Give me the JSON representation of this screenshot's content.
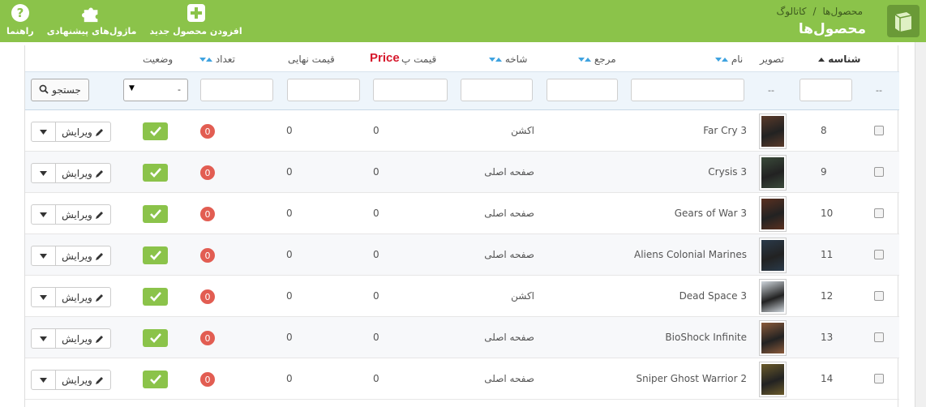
{
  "header": {
    "breadcrumb": [
      "کاتالوگ",
      "محصول‌ها"
    ],
    "breadcrumb_separator": "/",
    "title": "محصول‌ها",
    "toolbar": [
      {
        "label": "افزودن محصول جدید",
        "icon": "plus-square-icon"
      },
      {
        "label": "ماژول‌های پیشنهادی",
        "icon": "puzzle-icon"
      },
      {
        "label": "راهنما",
        "icon": "help-icon"
      }
    ],
    "bg_color": "#8bc34a"
  },
  "columns": {
    "id": "شناسه",
    "image": "تصویر",
    "name": "نام",
    "reference": "مرجع",
    "category": "شاخه",
    "base_price": "قیمت پ",
    "final_price": "قیمت نهایی",
    "quantity": "تعداد",
    "status": "وضعیت",
    "price_overlay": "Price"
  },
  "filters": {
    "id_dashes": "--",
    "image_dashes": "--",
    "status_select_value": "-",
    "search_label": "جستجو"
  },
  "rows": [
    {
      "id": "8",
      "name": "Far Cry 3",
      "category": "اکشن",
      "price": "0",
      "final_price": "0",
      "qty": "0",
      "edit": "ویرایش",
      "cover": "#5a3a2a"
    },
    {
      "id": "9",
      "name": "Crysis 3",
      "category": "صفحه اصلی",
      "price": "0",
      "final_price": "0",
      "qty": "0",
      "edit": "ویرایش",
      "cover": "#3a4a3a"
    },
    {
      "id": "10",
      "name": "Gears of War 3",
      "category": "صفحه اصلی",
      "price": "0",
      "final_price": "0",
      "qty": "0",
      "edit": "ویرایش",
      "cover": "#5a3020"
    },
    {
      "id": "11",
      "name": "Aliens Colonial Marines",
      "category": "صفحه اصلی",
      "price": "0",
      "final_price": "0",
      "qty": "0",
      "edit": "ویرایش",
      "cover": "#2a3a4a"
    },
    {
      "id": "12",
      "name": "Dead Space 3",
      "category": "اکشن",
      "price": "0",
      "final_price": "0",
      "qty": "0",
      "edit": "ویرایش",
      "cover": "#cfd6dc"
    },
    {
      "id": "13",
      "name": "BioShock Infinite",
      "category": "صفحه اصلی",
      "price": "0",
      "final_price": "0",
      "qty": "0",
      "edit": "ویرایش",
      "cover": "#8a5a3a"
    },
    {
      "id": "14",
      "name": "Sniper Ghost Warrior 2",
      "category": "صفحه اصلی",
      "price": "0",
      "final_price": "0",
      "qty": "0",
      "edit": "ویرایش",
      "cover": "#6a5a2a"
    }
  ]
}
